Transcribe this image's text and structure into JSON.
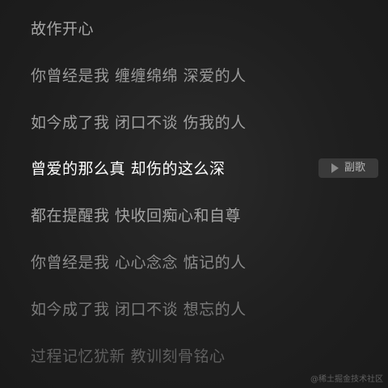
{
  "lyrics": {
    "lines": [
      "故作开心",
      "你曾经是我 缠缠绵绵 深爱的人",
      "如今成了我 闭口不谈 伤我的人",
      "曾爱的那么真 却伤的这么深",
      "都在提醒我 快收回痴心和自尊",
      "你曾经是我 心心念念 惦记的人",
      "如今成了我 闭口不谈 想忘的人",
      "过程记忆犹新 教训刻骨铭心"
    ],
    "active_index": 3
  },
  "chorus_button": {
    "label": "副歌",
    "icon": "play-icon"
  },
  "watermark": "@稀土掘金技术社区",
  "colors": {
    "background": "#1f1f1f",
    "active_lyric": "#ffffff",
    "inactive_lyric": "#9a9a9a",
    "button_bg": "#3a3a3a"
  }
}
